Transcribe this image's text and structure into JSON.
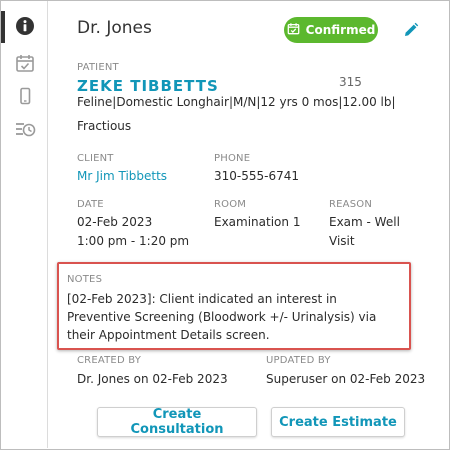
{
  "header": {
    "title": "Dr. Jones",
    "status_badge": "Confirmed"
  },
  "patient": {
    "label": "PATIENT",
    "name": "ZEKE TIBBETTS",
    "id": "315",
    "details_line1": "Feline|Domestic Longhair|M/N|12 yrs 0 mos|12.00 lb|",
    "details_line2": "Fractious"
  },
  "client": {
    "label": "CLIENT",
    "name": "Mr Jim Tibbetts"
  },
  "phone": {
    "label": "PHONE",
    "value": "310-555-6741"
  },
  "date": {
    "label": "DATE",
    "value": "02-Feb 2023",
    "time": "1:00 pm - 1:20 pm"
  },
  "room": {
    "label": "ROOM",
    "value": "Examination 1"
  },
  "reason": {
    "label": "REASON",
    "line1": "Exam - Well",
    "line2": "Visit"
  },
  "notes": {
    "label": "NOTES",
    "text": "[02-Feb 2023]: Client indicated an interest in Preventive Screening (Bloodwork +/- Urinalysis) via their Appointment Details screen."
  },
  "created_by": {
    "label": "CREATED BY",
    "value": "Dr. Jones on 02-Feb 2023"
  },
  "updated_by": {
    "label": "UPDATED BY",
    "value": "Superuser on 02-Feb 2023"
  },
  "actions": {
    "create_consultation": "Create Consultation",
    "create_estimate": "Create Estimate"
  },
  "colors": {
    "accent": "#1196b8",
    "confirmed": "#5cb82e",
    "highlight": "#d9534f"
  },
  "icons": {
    "rail": [
      "info-icon",
      "calendar-check-icon",
      "mobile-icon",
      "history-icon"
    ],
    "badge": "calendar-check-icon",
    "edit": "pencil-icon"
  }
}
